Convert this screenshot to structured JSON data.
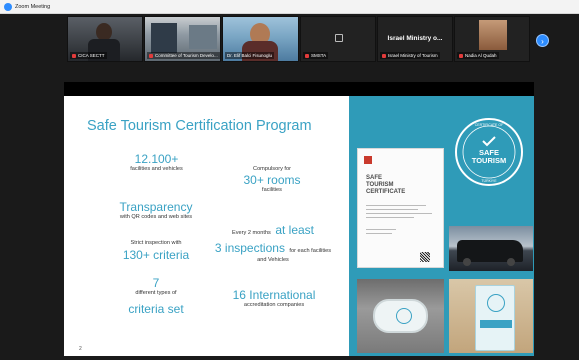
{
  "window": {
    "title": "Zoom Meeting"
  },
  "participants": [
    {
      "name": "CICA SECTT"
    },
    {
      "name": "Committee of Tourism Develo..."
    },
    {
      "name": "Dr. Elif Balci Fisunoglu"
    },
    {
      "name": "SMSTA"
    },
    {
      "name": "Israel Ministry of Tourism",
      "header": "Israel Ministry o..."
    },
    {
      "name": "Nadia Al Qudah"
    }
  ],
  "slide": {
    "title": "Safe Tourism Certification Program",
    "page_number": "2",
    "left_stats": [
      {
        "big": "12.100+",
        "small": "facilities and vehicles"
      },
      {
        "big": "Transparency",
        "small": "with QR codes and web sites"
      },
      {
        "small_top": "Strict inspection with",
        "big": "130+ criteria"
      },
      {
        "big": "7",
        "small": "different types of",
        "big2": "criteria set"
      }
    ],
    "right_stats": {
      "rooms": {
        "small_top": "Compulsory for",
        "big": "30+ rooms",
        "small": "facilities"
      },
      "inspections": {
        "prefix": "Every 2 months",
        "big_inline": "at least",
        "big": "3 inspections",
        "suffix": "for each facilities",
        "small": "and Vehicles"
      },
      "international": {
        "big": "16 International",
        "small": "accreditation companies"
      }
    },
    "certificate": {
      "line1": "SAFE",
      "line2": "TOURISM",
      "line3": "CERTIFICATE"
    },
    "badge": {
      "top": "CERTIFICATE OF",
      "line1": "SAFE",
      "line2": "TOURISM",
      "bottom": "TÜRKİYE"
    }
  },
  "colors": {
    "accent": "#3aa2c4",
    "zoom_blue": "#2d8cff",
    "mic_muted": "#e23b3b"
  },
  "icons": {
    "next": "chevron-right-icon",
    "mic": "mic-muted-icon",
    "logo": "zoom-logo-icon"
  }
}
